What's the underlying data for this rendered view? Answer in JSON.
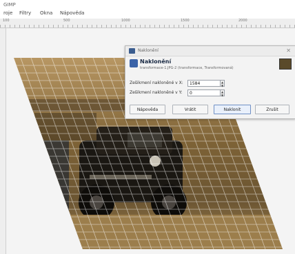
{
  "window": {
    "title": "GIMP"
  },
  "menubar": {
    "items": [
      "roje",
      "Filtry",
      "Okna",
      "Nápověda"
    ]
  },
  "ruler": {
    "labels": [
      "100",
      "500",
      "1000",
      "1500",
      "2000"
    ]
  },
  "dialog": {
    "title": "Naklonění",
    "heading": "Naklonění",
    "subtitle": "transformace-1.JPG-2 (transformace, Transformovaná)",
    "row1_label": "Zešikmení nakloněné v X:",
    "row1_value": "1584",
    "row2_label": "Zešikmení nakloněné v Y:",
    "row2_value": "0",
    "buttons": {
      "help": "Nápověda",
      "reset": "Vrátit",
      "shear": "Naklonit",
      "cancel": "Zrušit"
    }
  },
  "colors": {
    "accent": "#3b63a8",
    "canvas": "#f4f4f4",
    "photo_dark": "#2c2417",
    "photo_warm": "#9a7b45"
  },
  "canvas": {
    "content": "sheared photo of a vintage car with grid overlay"
  }
}
